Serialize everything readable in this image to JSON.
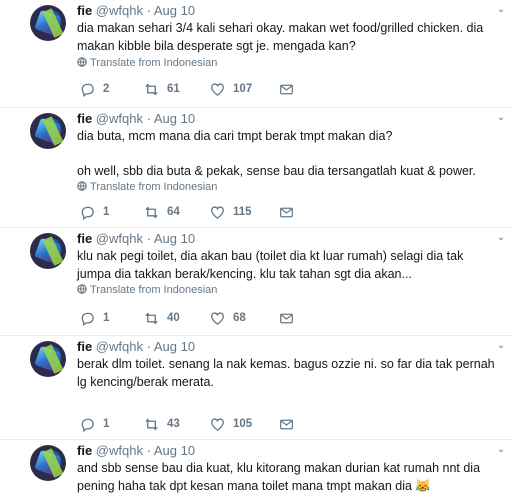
{
  "colors": {
    "text": "#14171a",
    "muted": "#657786",
    "divider": "#e6ecf0"
  },
  "translate_label": "Translate from Indonesian",
  "tweets": [
    {
      "name": "fie",
      "handle": "@wfqhk",
      "sep": "·",
      "date": "Aug 10",
      "lines": [
        "dia makan sehari 3/4 kali sehari okay. makan wet food/grilled chicken. dia makan kibble bila desperate sgt je. mengada kan?"
      ],
      "replies": "2",
      "retweets": "61",
      "likes": "107"
    },
    {
      "name": "fie",
      "handle": "@wfqhk",
      "sep": "·",
      "date": "Aug 10",
      "lines": [
        "dia buta, mcm mana dia cari tmpt berak tmpt makan dia?",
        "oh well, sbb dia buta & pekak, sense bau dia tersangatlah kuat & power."
      ],
      "replies": "1",
      "retweets": "64",
      "likes": "115"
    },
    {
      "name": "fie",
      "handle": "@wfqhk",
      "sep": "·",
      "date": "Aug 10",
      "lines": [
        "klu nak pegi toilet, dia akan bau (toilet dia kt luar rumah) selagi dia tak jumpa dia takkan berak/kencing. klu tak tahan sgt dia akan..."
      ],
      "replies": "1",
      "retweets": "40",
      "likes": "68"
    },
    {
      "name": "fie",
      "handle": "@wfqhk",
      "sep": "·",
      "date": "Aug 10",
      "lines": [
        "berak dlm toilet. senang la nak kemas. bagus ozzie ni. so far dia tak pernah lg kencing/berak merata."
      ],
      "replies": "1",
      "retweets": "43",
      "likes": "105"
    },
    {
      "name": "fie",
      "handle": "@wfqhk",
      "sep": "·",
      "date": "Aug 10",
      "lines": [
        "and sbb sense bau dia kuat, klu kitorang makan durian kat rumah nnt dia pening haha tak dpt kesan mana toilet mana tmpt makan dia 😹"
      ]
    }
  ]
}
